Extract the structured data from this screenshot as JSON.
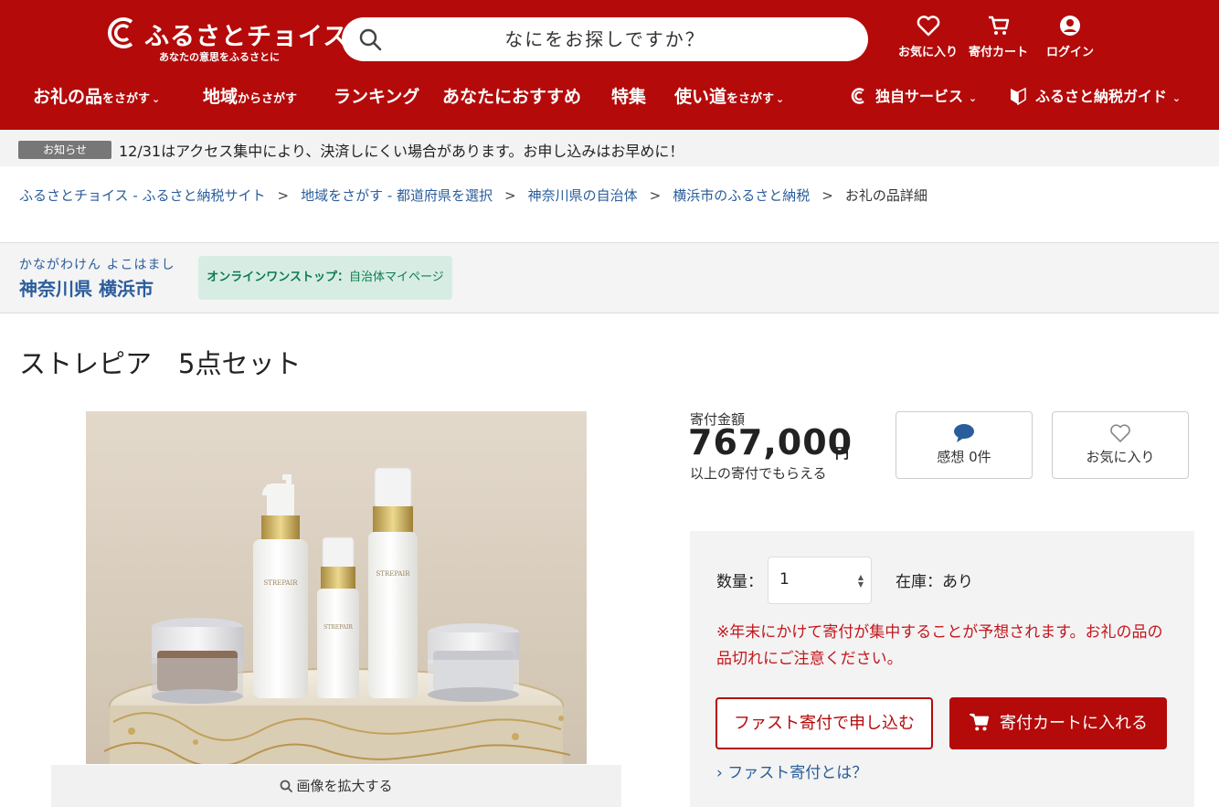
{
  "header": {
    "logo_text": "ふるさとチョイス",
    "logo_tagline": "あなたの意思をふるさとに",
    "search_placeholder": "なにをお探しですか？",
    "favorites_label": "お気に入り",
    "cart_label": "寄付カート",
    "login_label": "ログイン"
  },
  "gnav": {
    "items": [
      {
        "main": "お礼の品",
        "sub": "をさがす"
      },
      {
        "main": "地域",
        "sub": "からさがす"
      },
      {
        "main": "ランキング",
        "sub": ""
      },
      {
        "main": "あなたにおすすめ",
        "sub": ""
      },
      {
        "main": "特集",
        "sub": ""
      },
      {
        "main": "使い道",
        "sub": "をさがす"
      },
      {
        "main": "独自サービス",
        "sub": ""
      },
      {
        "main": "ふるさと納税ガイド",
        "sub": ""
      }
    ]
  },
  "notice": {
    "badge": "お知らせ",
    "text": "12/31はアクセス集中により、決済しにくい場合があります。お申し込みはお早めに！"
  },
  "breadcrumb": [
    "ふるさとチョイス - ふるさと納税サイト",
    "地域をさがす - 都道府県を選択",
    "神奈川県の自治体",
    "横浜市のふるさと納税",
    "お礼の品詳細"
  ],
  "breadcrumb_separator": ">",
  "municipality": {
    "kana": "かながわけん よこはまし",
    "name": "神奈川県 横浜市",
    "badge_bold": "オンラインワンストップ：",
    "badge_text": "自治体マイページ"
  },
  "product": {
    "title": "ストレピア　5点セット",
    "zoom_label": "画像を拡大する",
    "price_label": "寄付金額",
    "price": "767,000",
    "price_unit": "円",
    "price_note": "以上の寄付でもらえる",
    "review_label": "感想 0件",
    "favorite_label": "お気に入り",
    "quantity_label": "数量：",
    "quantity_value": "1",
    "stock_label": "在庫：あり",
    "warning": "※年末にかけて寄付が集中することが予想されます。お礼の品の品切れにご注意ください。",
    "fast_button": "ファスト寄付で申し込む",
    "cart_button": "寄付カートに入れる",
    "fast_link": "ファスト寄付とは？",
    "bottle_brand": "STREPAIR"
  },
  "colors": {
    "brand_red": "#b40a0a",
    "link_blue": "#2a5d9b",
    "warning_red": "#c4161c",
    "badge_green_bg": "#d7ede4"
  }
}
